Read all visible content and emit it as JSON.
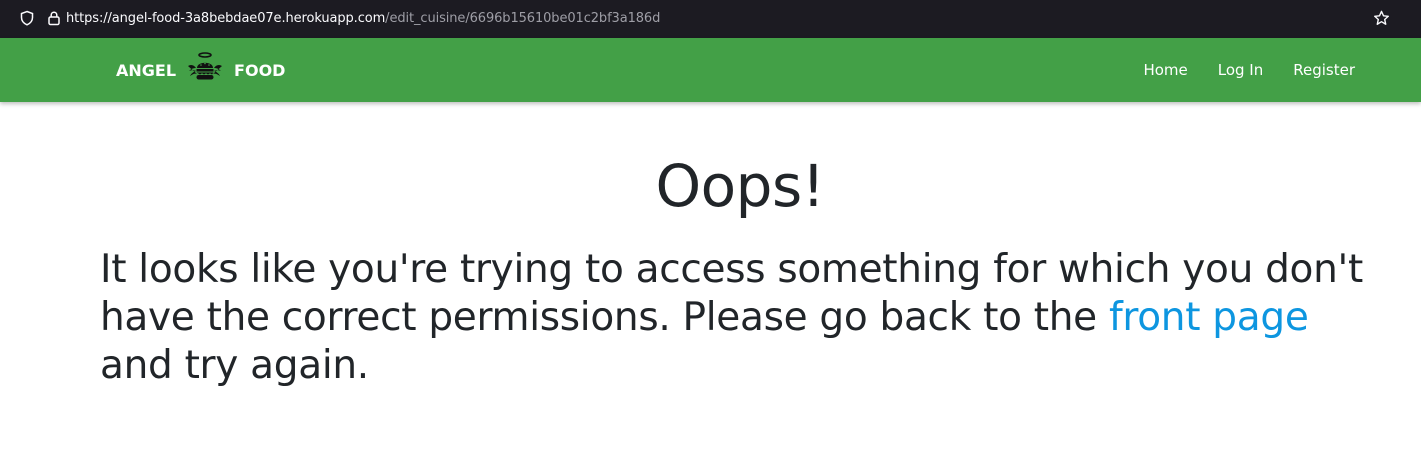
{
  "browser": {
    "url_host": "https://angel-food-3a8bebdae07e.herokuapp.com",
    "url_path": "/edit_cuisine/6696b15610be01c2bf3a186d",
    "icons": [
      "shield-icon",
      "lock-icon",
      "star-icon"
    ]
  },
  "navbar": {
    "brand_left": "ANGEL",
    "brand_right": "FOOD",
    "logo_icon": "winged-burger-logo",
    "links": [
      {
        "label": "Home"
      },
      {
        "label": "Log In"
      },
      {
        "label": "Register"
      }
    ],
    "color": "#43a047"
  },
  "main": {
    "title": "Oops!",
    "message_before": "It looks like you're trying to access something for which you don't have the correct permissions. Please go back to the ",
    "link_text": "front page",
    "message_after": " and try again.",
    "link_color": "#0d96e0"
  }
}
